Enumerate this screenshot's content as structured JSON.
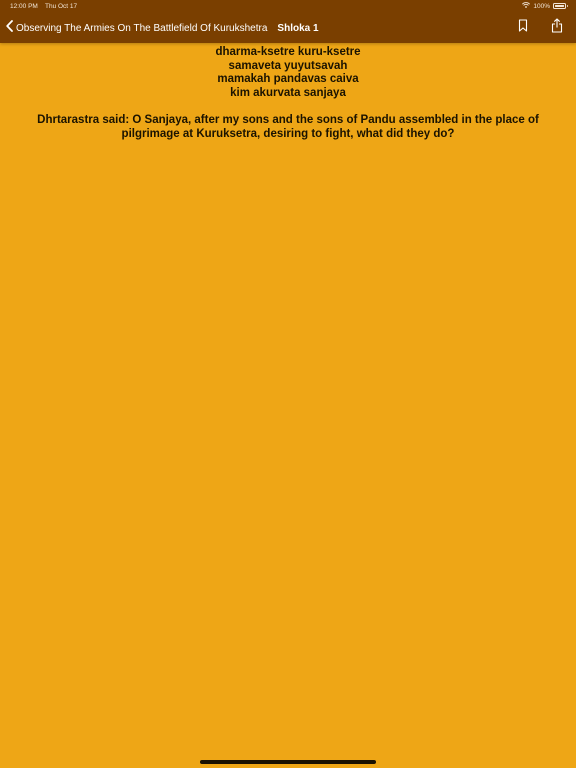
{
  "status_bar": {
    "time": "12:00 PM",
    "date": "Thu Oct 17",
    "battery_percent": "100%",
    "icons": [
      "wifi-icon",
      "battery-icon"
    ]
  },
  "nav": {
    "back_label": "Observing The Armies On The Battlefield Of Kurukshetra",
    "title": "Shloka 1",
    "actions": [
      "bookmark-icon",
      "share-icon"
    ]
  },
  "shloka": {
    "verse_lines": [
      "dharma-ksetre kuru-ksetre",
      "samaveta yuyutsavah",
      "mamakah pandavas caiva",
      "kim akurvata sanjaya"
    ],
    "translation": "Dhrtarastra said: O Sanjaya, after my sons and the sons of Pandu assembled in the place of pilgrimage at Kuruksetra, desiring to fight, what did they do?"
  },
  "colors": {
    "background": "#EEA616",
    "nav_bar": "#7A3F00",
    "text": "#1B1300"
  }
}
